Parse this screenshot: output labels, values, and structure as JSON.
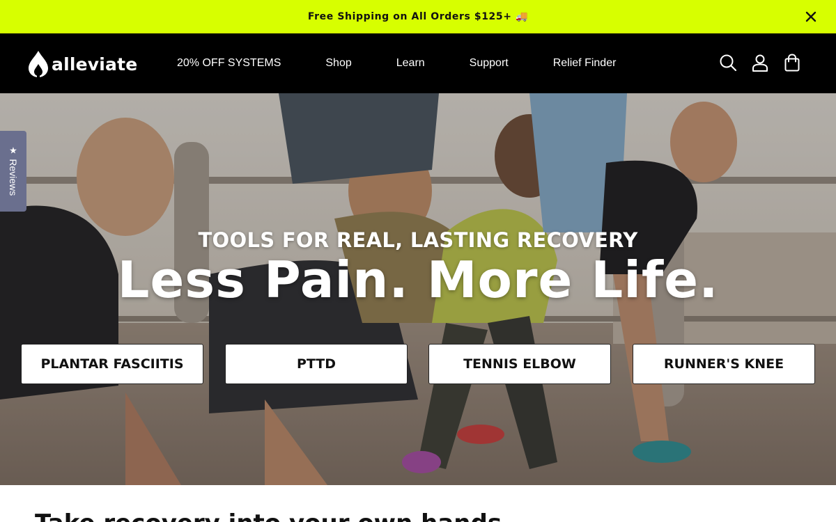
{
  "announcement": {
    "text": "Free Shipping on All Orders $125+ 🚚",
    "close_icon": "close-icon"
  },
  "header": {
    "logo_text": "alleviate",
    "logo_icon": "flame-drop-logo",
    "nav": [
      {
        "label": "20% OFF SYSTEMS"
      },
      {
        "label": "Shop"
      },
      {
        "label": "Learn"
      },
      {
        "label": "Support"
      },
      {
        "label": "Relief Finder"
      }
    ],
    "icons": [
      "search-icon",
      "account-icon",
      "cart-icon"
    ]
  },
  "hero": {
    "eyebrow": "TOOLS FOR REAL, LASTING RECOVERY",
    "headline": "Less Pain. More Life.",
    "buttons": [
      {
        "label": "PLANTAR FASCIITIS"
      },
      {
        "label": "PTTD"
      },
      {
        "label": "TENNIS ELBOW"
      },
      {
        "label": "RUNNER'S KNEE"
      }
    ]
  },
  "reviews_tab": {
    "label": "Reviews",
    "icon": "star-icon"
  },
  "section": {
    "title": "Take recovery into your own hands"
  },
  "colors": {
    "announcement_bg": "#d7ff00",
    "header_bg": "#000000",
    "reviews_tab_bg": "#6a6f8e"
  }
}
